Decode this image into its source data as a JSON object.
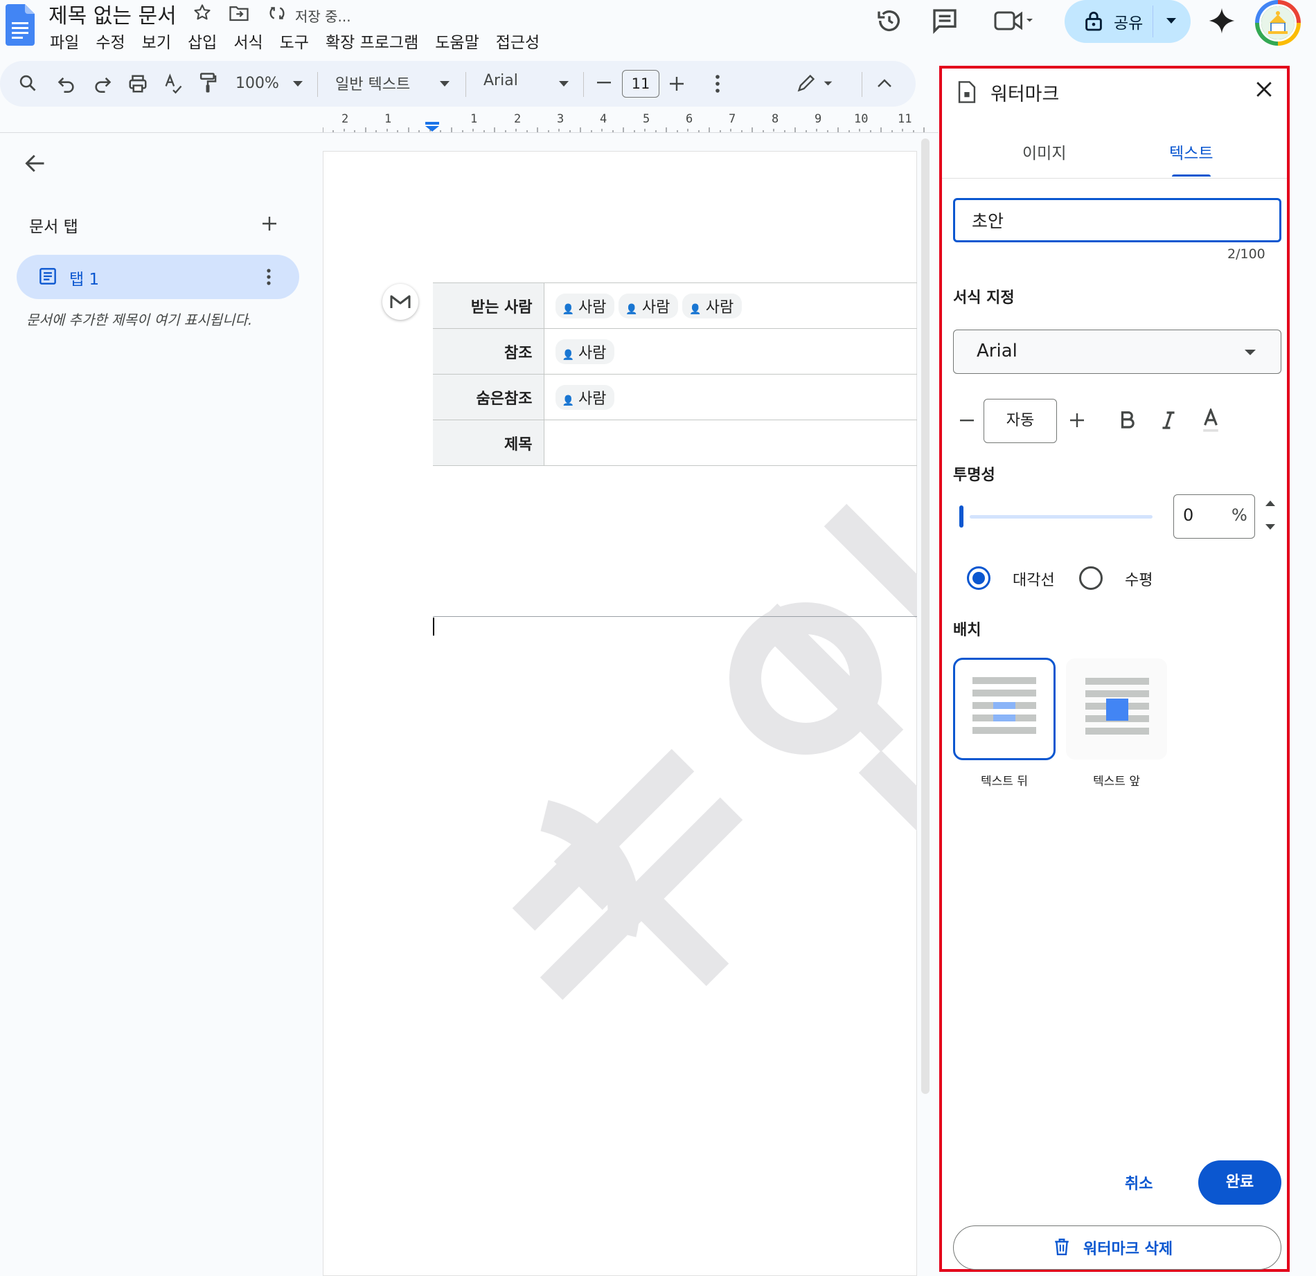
{
  "header": {
    "doc_title": "제목 없는 문서",
    "saving_status": "저장 중...",
    "share_label": "공유",
    "menu": [
      "파일",
      "수정",
      "보기",
      "삽입",
      "서식",
      "도구",
      "확장 프로그램",
      "도움말",
      "접근성"
    ]
  },
  "toolbar": {
    "zoom": "100%",
    "style": "일반 텍스트",
    "font": "Arial",
    "font_size": "11"
  },
  "ruler": [
    "2",
    "1",
    "1",
    "2",
    "3",
    "4",
    "5",
    "6",
    "7",
    "8",
    "9",
    "10",
    "11"
  ],
  "sidebar": {
    "section_label": "문서 탭",
    "tab_label": "탭 1",
    "hint": "문서에 추가한 제목이 여기 표시됩니다."
  },
  "document": {
    "rows": [
      {
        "key": "받는 사람",
        "chips": [
          "사람",
          "사람",
          "사람"
        ]
      },
      {
        "key": "참조",
        "chips": [
          "사람"
        ]
      },
      {
        "key": "숨은참조",
        "chips": [
          "사람"
        ]
      },
      {
        "key": "제목",
        "chips": []
      }
    ],
    "watermark_text": "초안"
  },
  "panel": {
    "title": "워터마크",
    "tabs": [
      "이미지",
      "텍스트"
    ],
    "text_value": "초안",
    "char_count": "2/100",
    "format_label": "서식 지정",
    "font": "Arial",
    "size_value": "자동",
    "opacity_label": "투명성",
    "opacity_value": "0",
    "opacity_unit": "%",
    "orientation": {
      "diagonal": "대각선",
      "horizontal": "수평"
    },
    "layout_label": "배치",
    "layout_options": [
      "텍스트 뒤",
      "텍스트 앞"
    ],
    "cancel_label": "취소",
    "done_label": "완료",
    "delete_label": "워터마크 삭제"
  },
  "colors": {
    "accent": "#0b57d0",
    "share_bg": "#c2e7ff",
    "tab_bg": "#d3e3fd",
    "highlight_border": "#e3001b"
  }
}
